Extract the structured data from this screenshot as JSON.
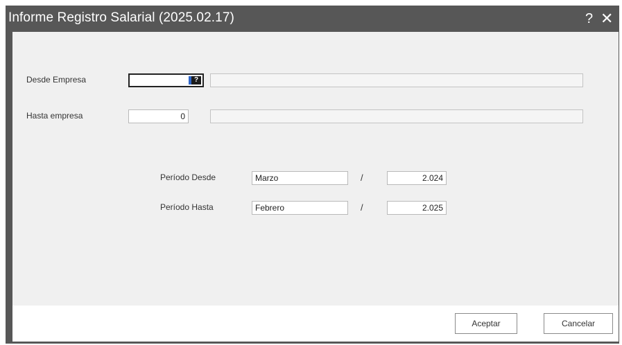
{
  "window": {
    "title": "Informe Registro Salarial (2025.02.17)",
    "help_label": "?",
    "close_label": "✕"
  },
  "form": {
    "desde_empresa": {
      "label": "Desde Empresa",
      "value": "",
      "cursor_glyph": "?"
    },
    "hasta_empresa": {
      "label": "Hasta empresa",
      "value": "0"
    },
    "periodo_desde": {
      "label": "Período Desde",
      "month": "Marzo",
      "separator": "/",
      "year": "2.024"
    },
    "periodo_hasta": {
      "label": "Período Hasta",
      "month": "Febrero",
      "separator": "/",
      "year": "2.025"
    }
  },
  "buttons": {
    "accept_label": "Aceptar",
    "cancel_label": "Cancelar"
  },
  "colors": {
    "titlebar": "#575757",
    "content_bg": "#f0f0f0",
    "field_border": "#b9b9b9"
  }
}
